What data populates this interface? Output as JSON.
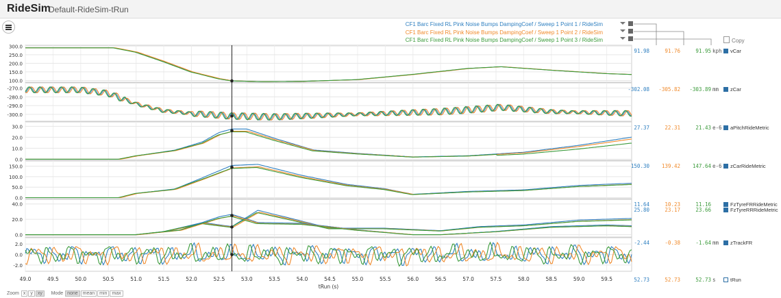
{
  "app": {
    "title": "RideSim",
    "document": "Default-RideSim-tRun"
  },
  "legend": {
    "runs": [
      {
        "label": "CF1 Barc Fixed RL Pink Noise Bumps DampingCoef / Sweep 1 Point 1 / RideSim",
        "color": "#2e7fc0"
      },
      {
        "label": "CF1 Barc Fixed RL Pink Noise Bumps DampingCoef / Sweep 1 Point 2 / RideSim",
        "color": "#f08a2b"
      },
      {
        "label": "CF1 Barc Fixed RL Pink Noise Bumps DampingCoef / Sweep 1 Point 3 / RideSim",
        "color": "#3a9a3a"
      }
    ],
    "copy_label": "Copy"
  },
  "colors": {
    "run1": "#2e7fc0",
    "run2": "#f08a2b",
    "run3": "#3a9a3a",
    "cursor": "#222222",
    "channel": "#2d6fa5"
  },
  "chart_data": {
    "type": "line",
    "xlabel": "tRun (s)",
    "xlim": [
      49.0,
      59.95
    ],
    "x_ticks": [
      "49.0",
      "49.5",
      "50.0",
      "50.5",
      "51.0",
      "51.5",
      "52.0",
      "52.5",
      "53.0",
      "53.5",
      "54.0",
      "54.5",
      "55.0",
      "55.5",
      "56.0",
      "56.5",
      "57.0",
      "57.5",
      "58.0",
      "58.5",
      "59.0",
      "59.5"
    ],
    "cursor_x": 52.73,
    "panels": [
      {
        "name": "vCar",
        "unit": "kph",
        "ylim": [
          90,
          305
        ],
        "yticks": [
          "300.0",
          "250.0",
          "200.0",
          "150.0",
          "100.0"
        ],
        "ytick_values": [
          300,
          250,
          200,
          150,
          100
        ],
        "values": [
          "91.98",
          "91.76",
          "91.95"
        ],
        "key": [
          [
            49.0,
            290
          ],
          [
            50.6,
            290
          ],
          [
            51.0,
            265
          ],
          [
            51.5,
            210
          ],
          [
            52.0,
            150
          ],
          [
            52.5,
            110
          ],
          [
            52.73,
            98
          ],
          [
            53.3,
            93
          ],
          [
            54.0,
            95
          ],
          [
            55.0,
            105
          ],
          [
            56.0,
            135
          ],
          [
            57.0,
            170
          ],
          [
            57.6,
            180
          ],
          [
            58.5,
            160
          ],
          [
            59.5,
            140
          ],
          [
            59.95,
            135
          ]
        ]
      },
      {
        "name": "zCar",
        "unit": "mm",
        "ylim": [
          -308,
          -264
        ],
        "yticks": [
          "-270.0",
          "-280.0",
          "-290.0",
          "-300.0"
        ],
        "ytick_values": [
          -270,
          -280,
          -290,
          -300
        ],
        "values": [
          "-302.08",
          "-305.82",
          "-303.89"
        ],
        "key": [
          [
            49.0,
            -272
          ],
          [
            50.0,
            -272
          ],
          [
            50.5,
            -276
          ],
          [
            51.0,
            -288
          ],
          [
            51.5,
            -296
          ],
          [
            52.0,
            -299
          ],
          [
            52.73,
            -302
          ],
          [
            53.5,
            -303
          ],
          [
            54.5,
            -301
          ],
          [
            55.5,
            -299
          ],
          [
            56.5,
            -297
          ],
          [
            57.0,
            -295
          ],
          [
            57.6,
            -292
          ],
          [
            58.5,
            -297
          ],
          [
            59.95,
            -299
          ]
        ]
      },
      {
        "name": "aPitchRideMetric",
        "unit": "e-6",
        "ylim": [
          -1,
          34
        ],
        "yticks": [
          "30.0",
          "20.0",
          "10.0",
          "0.0"
        ],
        "ytick_values": [
          30,
          20,
          10,
          0
        ],
        "values": [
          "27.37",
          "22.31",
          "21.43"
        ],
        "key": [
          [
            49.0,
            0
          ],
          [
            50.7,
            0
          ],
          [
            51.0,
            3
          ],
          [
            51.7,
            8
          ],
          [
            52.2,
            15
          ],
          [
            52.5,
            23
          ],
          [
            52.73,
            26
          ],
          [
            53.0,
            26
          ],
          [
            53.5,
            18
          ],
          [
            54.2,
            8
          ],
          [
            55.0,
            5
          ],
          [
            56.0,
            2
          ],
          [
            57.0,
            3
          ],
          [
            58.0,
            6
          ],
          [
            59.0,
            12
          ],
          [
            59.95,
            19
          ]
        ]
      },
      {
        "name": "zCarRideMetric",
        "unit": "e-6",
        "ylim": [
          -5,
          175
        ],
        "yticks": [
          "150.0",
          "100.0",
          "50.0",
          "0.0"
        ],
        "ytick_values": [
          150,
          100,
          50,
          0
        ],
        "values": [
          "150.30",
          "139.42",
          "147.64"
        ],
        "key": [
          [
            49.0,
            0
          ],
          [
            50.7,
            0
          ],
          [
            51.0,
            20
          ],
          [
            51.7,
            40
          ],
          [
            52.2,
            90
          ],
          [
            52.73,
            145
          ],
          [
            53.2,
            150
          ],
          [
            54.0,
            100
          ],
          [
            54.8,
            60
          ],
          [
            55.5,
            40
          ],
          [
            56.0,
            15
          ],
          [
            57.0,
            28
          ],
          [
            58.0,
            35
          ],
          [
            59.0,
            55
          ],
          [
            59.95,
            65
          ]
        ]
      },
      {
        "name": "FzTyreFRRideMetric",
        "unit": "",
        "ylim": [
          -3,
          46
        ],
        "yticks": [
          "40.0",
          "20.0",
          "0.0"
        ],
        "ytick_values": [
          40,
          20,
          0
        ],
        "values": [
          "11.64",
          "10.23",
          "11.16"
        ],
        "key": [
          [
            49.0,
            0
          ],
          [
            51.0,
            0
          ],
          [
            51.5,
            4
          ],
          [
            52.2,
            15
          ],
          [
            52.73,
            10
          ],
          [
            53.2,
            30
          ],
          [
            53.8,
            20
          ],
          [
            54.5,
            8
          ],
          [
            55.5,
            8
          ],
          [
            56.5,
            5
          ],
          [
            57.2,
            10
          ],
          [
            58.0,
            12
          ],
          [
            59.0,
            18
          ],
          [
            59.95,
            20
          ]
        ]
      },
      {
        "name": "FzTyreRRRideMetric",
        "unit": "",
        "ylim": [
          -3,
          46
        ],
        "yticks": [],
        "ytick_values": [],
        "values": [
          "25.80",
          "23.17",
          "23.66"
        ],
        "key": [
          [
            49.0,
            0
          ],
          [
            51.0,
            0
          ],
          [
            51.8,
            6
          ],
          [
            52.5,
            22
          ],
          [
            52.73,
            25
          ],
          [
            53.2,
            15
          ],
          [
            54.0,
            14
          ],
          [
            55.0,
            6
          ],
          [
            56.0,
            0
          ],
          [
            56.5,
            0
          ],
          [
            57.5,
            4
          ],
          [
            58.5,
            10
          ],
          [
            59.5,
            12
          ],
          [
            59.95,
            11
          ]
        ]
      },
      {
        "name": "zTrackFR",
        "unit": "mm",
        "ylim": [
          -3.2,
          3.2
        ],
        "yticks": [
          "2.0",
          "0.0",
          "-2.0"
        ],
        "ytick_values": [
          2,
          0,
          -2
        ],
        "values": [
          "-2.44",
          "-0.38",
          "-1.64"
        ],
        "key": [
          [
            49.0,
            0
          ],
          [
            59.95,
            0
          ]
        ]
      },
      {
        "name": "tRun",
        "unit": "s",
        "ylim": null,
        "yticks": [],
        "ytick_values": [],
        "values": [
          "52.73",
          "52.73",
          "52.73"
        ],
        "key": []
      }
    ]
  },
  "footer": {
    "zoom_label": "Zoom",
    "zoom_opts": [
      "x",
      "y",
      "xy"
    ],
    "zoom_selected": "xy",
    "mode_label": "Mode",
    "mode_opts": [
      "none",
      "mean",
      "min",
      "max"
    ],
    "mode_selected": "none"
  }
}
